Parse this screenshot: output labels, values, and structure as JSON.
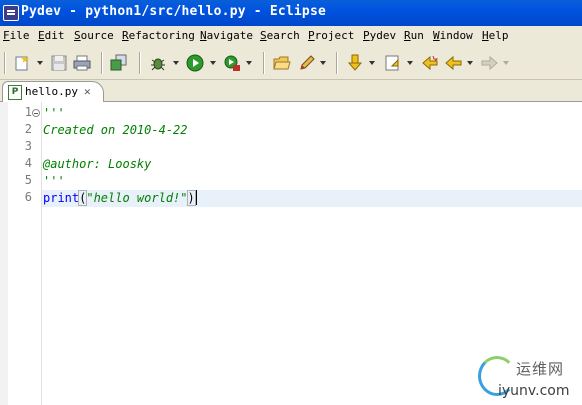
{
  "window": {
    "title": "Pydev - python1/src/hello.py - Eclipse"
  },
  "menu": [
    "File",
    "Edit",
    "Source",
    "Refactoring",
    "Navigate",
    "Search",
    "Project",
    "Pydev",
    "Run",
    "Window",
    "Help"
  ],
  "toolbar": {
    "icons": [
      "new-icon",
      "save-icon",
      "print-icon",
      "pydev-perspective-icon",
      "debug-icon",
      "run-icon",
      "external-tools-icon",
      "open-folder-icon",
      "pencil-icon",
      "next-annotation-icon",
      "previous-annotation-icon",
      "last-edit-icon",
      "back-icon",
      "forward-icon"
    ]
  },
  "editor_tab": {
    "label": "hello.py",
    "icon": "P",
    "close": "✕"
  },
  "code": {
    "line_numbers": [
      "1",
      "2",
      "3",
      "4",
      "5",
      "6"
    ],
    "lines": {
      "l1": "'''",
      "l2": "Created on 2010-4-22",
      "l3": "",
      "l4": "@author: Loosky",
      "l5": "'''",
      "l6_kw": "print",
      "l6_open": "(",
      "l6_str": "\"hello world!\"",
      "l6_close": ")"
    }
  },
  "watermark": {
    "brand_cn": "运维网",
    "url": "iyunv.com"
  },
  "colors": {
    "titlebar": "#0054e3",
    "chrome": "#ece9d8",
    "comment": "#008000",
    "keyword": "#0000ff",
    "current_line": "#e8f0fa"
  }
}
